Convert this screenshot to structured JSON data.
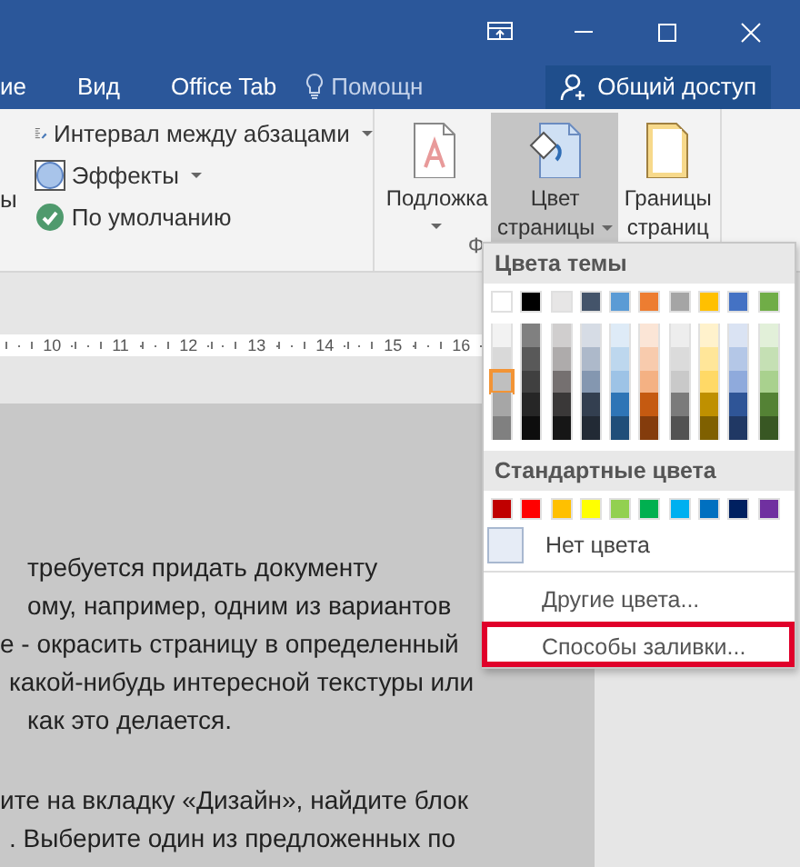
{
  "window": {
    "tabs": [
      {
        "label": "ие",
        "selected": false
      },
      {
        "label": "Вид",
        "selected": false
      },
      {
        "label": "Office Tab",
        "selected": false
      }
    ],
    "help": "Помощн",
    "share_button": "Общий доступ"
  },
  "ribbon": {
    "cut_label": "ы",
    "design_items": [
      {
        "label": "Интервал между абзацами",
        "kind": "spacing",
        "dropdown": true
      },
      {
        "label": "Эффекты",
        "kind": "effects",
        "dropdown": true
      },
      {
        "label": "По умолчанию",
        "kind": "default",
        "dropdown": false
      }
    ],
    "buttons": [
      {
        "label": "Подложка",
        "kind": "watermark",
        "dropdown": true,
        "pressed": false
      },
      {
        "label": "Цвет страницы",
        "kind": "page-color",
        "dropdown": true,
        "pressed": true
      },
      {
        "label": "Границы страниц",
        "kind": "page-borders",
        "dropdown": false,
        "pressed": false
      }
    ],
    "group_label": "Ф"
  },
  "ruler": {
    "labels": [
      "10",
      "11",
      "12",
      "13",
      "14",
      "15",
      "16"
    ]
  },
  "document": {
    "paragraphs": [
      {
        "lines": [
          "требуется придать документу",
          "ому, например, одним из вариантов",
          "е - окрасить страницу в определенный",
          "какой-нибудь интересной текстуры или",
          "как это делается."
        ]
      },
      {
        "lines": [
          "ите на вкладку «Дизайн», найдите блок",
          ". Выберите один из предложенных по"
        ]
      }
    ]
  },
  "color_menu": {
    "theme_heading": "Цвета темы",
    "theme_colors": [
      {
        "swatches": [
          {
            "color": "#ffffff",
            "selected": false
          },
          {
            "color": "#f2f2f2",
            "selected": false
          },
          {
            "color": "#d9d9d9",
            "selected": false
          },
          {
            "color": "#bfbfbf",
            "selected": true
          },
          {
            "color": "#a6a6a6",
            "selected": false
          },
          {
            "color": "#808080",
            "selected": false
          }
        ]
      },
      {
        "swatches": [
          {
            "color": "#000000",
            "selected": false
          },
          {
            "color": "#808080",
            "selected": false
          },
          {
            "color": "#595959",
            "selected": false
          },
          {
            "color": "#404040",
            "selected": false
          },
          {
            "color": "#262626",
            "selected": false
          },
          {
            "color": "#0d0d0d",
            "selected": false
          }
        ]
      },
      {
        "swatches": [
          {
            "color": "#e7e6e6",
            "selected": false
          },
          {
            "color": "#d0cece",
            "selected": false
          },
          {
            "color": "#aeabab",
            "selected": false
          },
          {
            "color": "#757070",
            "selected": false
          },
          {
            "color": "#3a3838",
            "selected": false
          },
          {
            "color": "#161616",
            "selected": false
          }
        ]
      },
      {
        "swatches": [
          {
            "color": "#44546a",
            "selected": false
          },
          {
            "color": "#d6dce5",
            "selected": false
          },
          {
            "color": "#adb9ca",
            "selected": false
          },
          {
            "color": "#8497b0",
            "selected": false
          },
          {
            "color": "#333f50",
            "selected": false
          },
          {
            "color": "#222a35",
            "selected": false
          }
        ]
      },
      {
        "swatches": [
          {
            "color": "#5b9bd5",
            "selected": false
          },
          {
            "color": "#deebf7",
            "selected": false
          },
          {
            "color": "#bdd7ee",
            "selected": false
          },
          {
            "color": "#9dc3e6",
            "selected": false
          },
          {
            "color": "#2e75b6",
            "selected": false
          },
          {
            "color": "#1f4e79",
            "selected": false
          }
        ]
      },
      {
        "swatches": [
          {
            "color": "#ed7d31",
            "selected": false
          },
          {
            "color": "#fbe5d6",
            "selected": false
          },
          {
            "color": "#f8cbad",
            "selected": false
          },
          {
            "color": "#f4b183",
            "selected": false
          },
          {
            "color": "#c55a11",
            "selected": false
          },
          {
            "color": "#843c0c",
            "selected": false
          }
        ]
      },
      {
        "swatches": [
          {
            "color": "#a5a5a5",
            "selected": false
          },
          {
            "color": "#ededed",
            "selected": false
          },
          {
            "color": "#dbdbdb",
            "selected": false
          },
          {
            "color": "#c9c9c9",
            "selected": false
          },
          {
            "color": "#7b7b7b",
            "selected": false
          },
          {
            "color": "#525252",
            "selected": false
          }
        ]
      },
      {
        "swatches": [
          {
            "color": "#ffc000",
            "selected": false
          },
          {
            "color": "#fff2cc",
            "selected": false
          },
          {
            "color": "#ffe699",
            "selected": false
          },
          {
            "color": "#ffd966",
            "selected": false
          },
          {
            "color": "#bf9000",
            "selected": false
          },
          {
            "color": "#7f6000",
            "selected": false
          }
        ]
      },
      {
        "swatches": [
          {
            "color": "#4472c4",
            "selected": false
          },
          {
            "color": "#dae3f3",
            "selected": false
          },
          {
            "color": "#b4c7e7",
            "selected": false
          },
          {
            "color": "#8faadc",
            "selected": false
          },
          {
            "color": "#2f5597",
            "selected": false
          },
          {
            "color": "#203864",
            "selected": false
          }
        ]
      },
      {
        "swatches": [
          {
            "color": "#70ad47",
            "selected": false
          },
          {
            "color": "#e2f0d9",
            "selected": false
          },
          {
            "color": "#c5e0b4",
            "selected": false
          },
          {
            "color": "#a9d18e",
            "selected": false
          },
          {
            "color": "#548235",
            "selected": false
          },
          {
            "color": "#385723",
            "selected": false
          }
        ]
      }
    ],
    "standard_heading": "Стандартные цвета",
    "standard_colors": [
      {
        "color": "#c00000",
        "selected": false
      },
      {
        "color": "#ff0000",
        "selected": false
      },
      {
        "color": "#ffc000",
        "selected": false
      },
      {
        "color": "#ffff00",
        "selected": false
      },
      {
        "color": "#92d050",
        "selected": false
      },
      {
        "color": "#00b050",
        "selected": false
      },
      {
        "color": "#00b0f0",
        "selected": false
      },
      {
        "color": "#0070c0",
        "selected": false
      },
      {
        "color": "#002060",
        "selected": false
      },
      {
        "color": "#7030a0",
        "selected": false
      }
    ],
    "no_color": "Нет цвета",
    "items": [
      {
        "label": "Другие цвета...",
        "highlighted": false
      },
      {
        "label": "Способы заливки...",
        "highlighted": true
      }
    ]
  }
}
